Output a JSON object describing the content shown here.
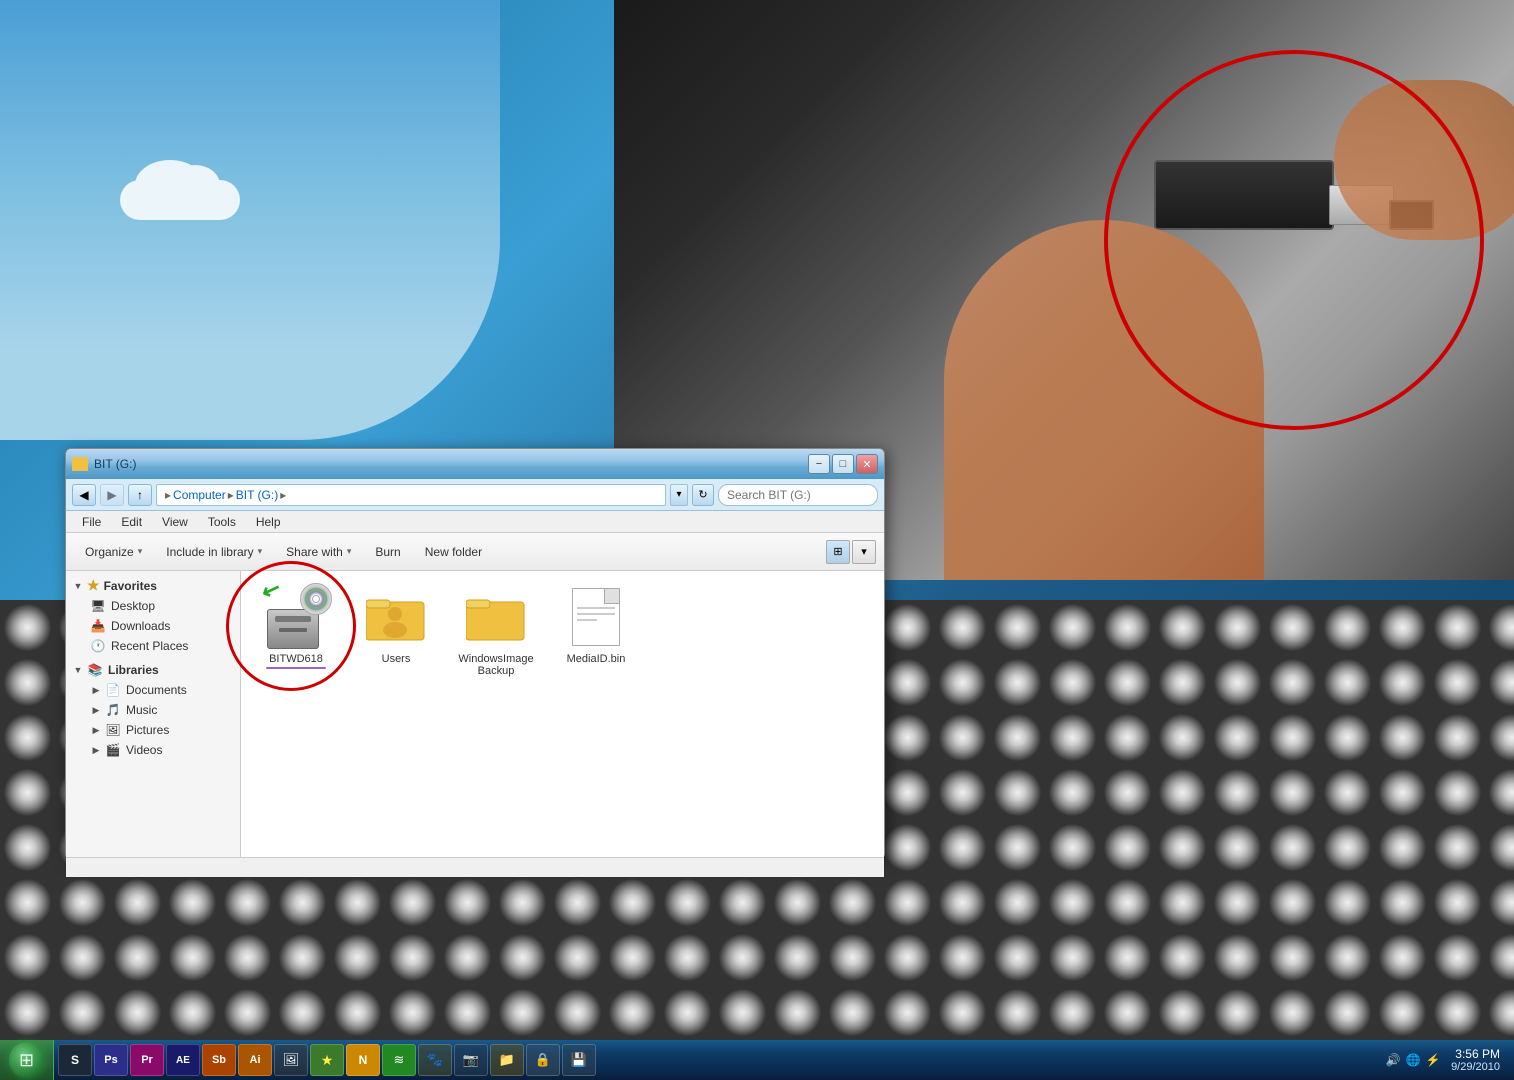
{
  "desktop": {
    "background_desc": "Windows 7 desktop with USB drive photo"
  },
  "window": {
    "title": "BIT (G:)",
    "title_bar": {
      "minimize_label": "−",
      "maximize_label": "□",
      "close_label": "✕"
    },
    "address_bar": {
      "back_label": "◀",
      "forward_label": "▶",
      "dropdown_label": "▾",
      "refresh_label": "↻",
      "path_parts": [
        "Computer",
        "BIT (G:)"
      ],
      "search_placeholder": "Search BIT (G:)"
    },
    "menu": {
      "items": [
        "File",
        "Edit",
        "View",
        "Tools",
        "Help"
      ]
    },
    "toolbar": {
      "organize_label": "Organize",
      "include_library_label": "Include in library",
      "share_with_label": "Share with",
      "burn_label": "Burn",
      "new_folder_label": "New folder",
      "dropdown_arrow": "▾"
    },
    "sidebar": {
      "favorites_label": "Favorites",
      "desktop_label": "Desktop",
      "downloads_label": "Downloads",
      "recent_places_label": "Recent Places",
      "libraries_label": "Libraries",
      "documents_label": "Documents",
      "music_label": "Music",
      "pictures_label": "Pictures",
      "videos_label": "Videos"
    },
    "files": [
      {
        "name": "BITWD618",
        "type": "drive",
        "has_red_circle": true,
        "has_green_arrow": true
      },
      {
        "name": "Users",
        "type": "folder"
      },
      {
        "name": "WindowsImageBackup",
        "type": "folder"
      },
      {
        "name": "MediaID.bin",
        "type": "document"
      }
    ],
    "status_bar": {
      "text": ""
    }
  },
  "taskbar": {
    "time": "3:56 PM",
    "date": "9/29/2010",
    "apps": [
      {
        "name": "Steam",
        "class": "tb-steam",
        "label": "S"
      },
      {
        "name": "Photoshop",
        "class": "tb-ps",
        "label": "Ps"
      },
      {
        "name": "Premiere",
        "class": "tb-pr",
        "label": "Pr"
      },
      {
        "name": "After Effects",
        "class": "tb-ae",
        "label": "AE"
      },
      {
        "name": "Soundbooth",
        "class": "tb-sb",
        "label": "Sb"
      },
      {
        "name": "Illustrator",
        "class": "tb-ai",
        "label": "Ai"
      },
      {
        "name": "Image",
        "class": "tb-img",
        "label": "🖼"
      },
      {
        "name": "Star",
        "class": "tb-star",
        "label": "★"
      },
      {
        "name": "Norton",
        "class": "tb-norton",
        "label": "N"
      },
      {
        "name": "Green App",
        "class": "tb-green",
        "label": "≋"
      },
      {
        "name": "Animal",
        "class": "tb-animal",
        "label": "🐾"
      },
      {
        "name": "Camera",
        "class": "tb-cam",
        "label": "📷"
      },
      {
        "name": "Folder",
        "class": "tb-folder",
        "label": "📁"
      },
      {
        "name": "Lock",
        "class": "tb-lock",
        "label": "🔒"
      },
      {
        "name": "Drive",
        "class": "tb-drive",
        "label": "💾"
      }
    ],
    "tray_icons": [
      "🔊",
      "🌐",
      "⚡"
    ]
  }
}
